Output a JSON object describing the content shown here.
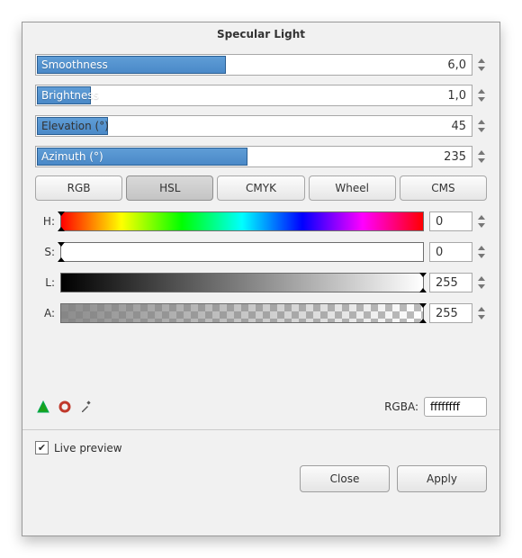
{
  "dialog": {
    "title": "Specular Light"
  },
  "sliders": [
    {
      "label": "Smoothness",
      "value": "6,0",
      "fill_pct": 43,
      "label_in_fill": true
    },
    {
      "label": "Brightness",
      "value": "1,0",
      "fill_pct": 12,
      "label_in_fill": true
    },
    {
      "label": "Elevation (°)",
      "value": "45",
      "fill_pct": 16,
      "label_in_fill": false
    },
    {
      "label": "Azimuth (°)",
      "value": "235",
      "fill_pct": 48,
      "label_in_fill": true
    }
  ],
  "color_tabs": {
    "items": [
      "RGB",
      "HSL",
      "CMYK",
      "Wheel",
      "CMS"
    ],
    "active_index": 1
  },
  "hsl": {
    "channels": [
      {
        "key": "H:",
        "value": "0",
        "kind": "hue",
        "marker_pct": 0
      },
      {
        "key": "S:",
        "value": "0",
        "kind": "sat",
        "marker_pct": 0
      },
      {
        "key": "L:",
        "value": "255",
        "kind": "light",
        "marker_pct": 100
      },
      {
        "key": "A:",
        "value": "255",
        "kind": "alpha",
        "marker_pct": 100
      }
    ]
  },
  "rgba": {
    "label": "RGBA:",
    "value": "ffffffff"
  },
  "icons": {
    "swatch_fill": "swatch-fill-icon",
    "swatch_stroke": "swatch-stroke-icon",
    "eyedropper": "eyedropper-icon"
  },
  "live_preview": {
    "label": "Live preview",
    "checked": true
  },
  "buttons": {
    "close": "Close",
    "apply": "Apply"
  }
}
